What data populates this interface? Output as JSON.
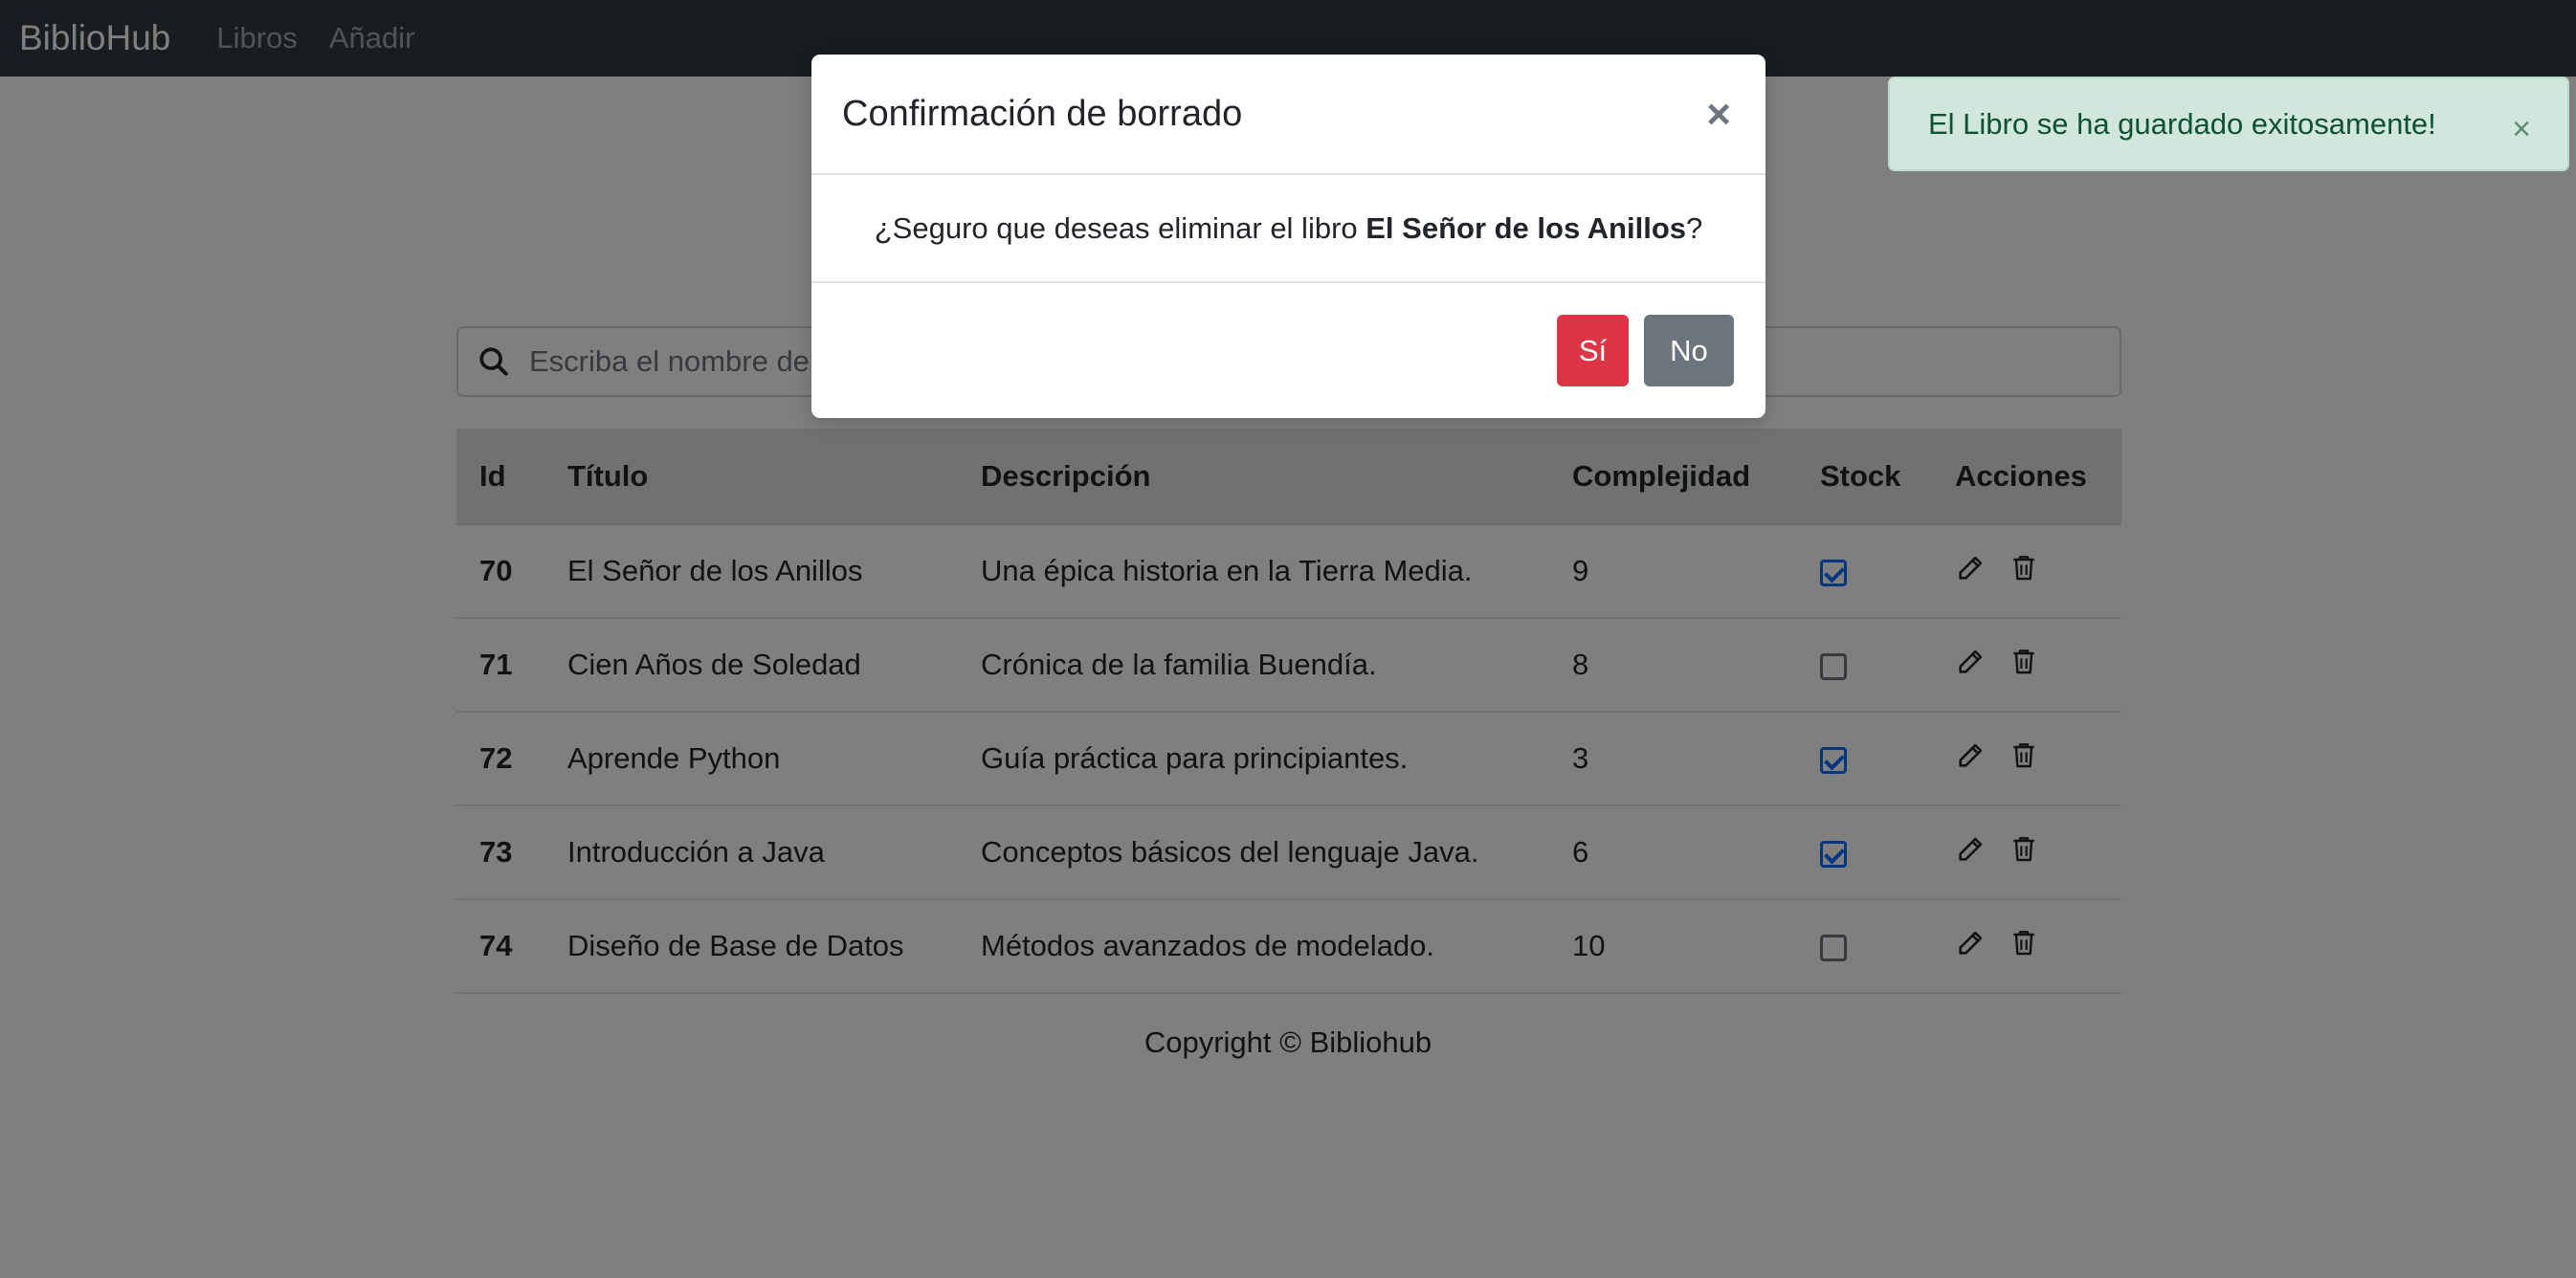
{
  "navbar": {
    "brand": "BiblioHub",
    "links": [
      "Libros",
      "Añadir"
    ]
  },
  "search": {
    "placeholder": "Escriba el nombre del libro..."
  },
  "table": {
    "headers": [
      "Id",
      "Título",
      "Descripción",
      "Complejidad",
      "Stock",
      "Acciones"
    ],
    "rows": [
      {
        "id": "70",
        "title": "El Señor de los Anillos",
        "description": "Una épica historia en la Tierra Media.",
        "complexity": "9",
        "stock": true
      },
      {
        "id": "71",
        "title": "Cien Años de Soledad",
        "description": "Crónica de la familia Buendía.",
        "complexity": "8",
        "stock": false
      },
      {
        "id": "72",
        "title": "Aprende Python",
        "description": "Guía práctica para principiantes.",
        "complexity": "3",
        "stock": true
      },
      {
        "id": "73",
        "title": "Introducción a Java",
        "description": "Conceptos básicos del lenguaje Java.",
        "complexity": "6",
        "stock": true
      },
      {
        "id": "74",
        "title": "Diseño de Base de Datos",
        "description": "Métodos avanzados de modelado.",
        "complexity": "10",
        "stock": false
      }
    ],
    "action_icons": [
      "edit-icon",
      "trash-icon"
    ]
  },
  "footer": {
    "text": "Copyright © Bibliohub"
  },
  "toast": {
    "message": "El Libro se ha guardado exitosamente!",
    "close": "×"
  },
  "modal": {
    "title": "Confirmación de borrado",
    "close": "×",
    "body_prefix": "¿Seguro que deseas eliminar el libro ",
    "body_book": "El Señor de los Anillos",
    "body_suffix": "?",
    "yes_label": "Sí",
    "no_label": "No"
  },
  "colors": {
    "navbar": "#343a40",
    "danger": "#dc3545",
    "secondary": "#6c757d",
    "success_bg": "#d1e7dd",
    "checkbox_checked": "#0d6efd"
  }
}
